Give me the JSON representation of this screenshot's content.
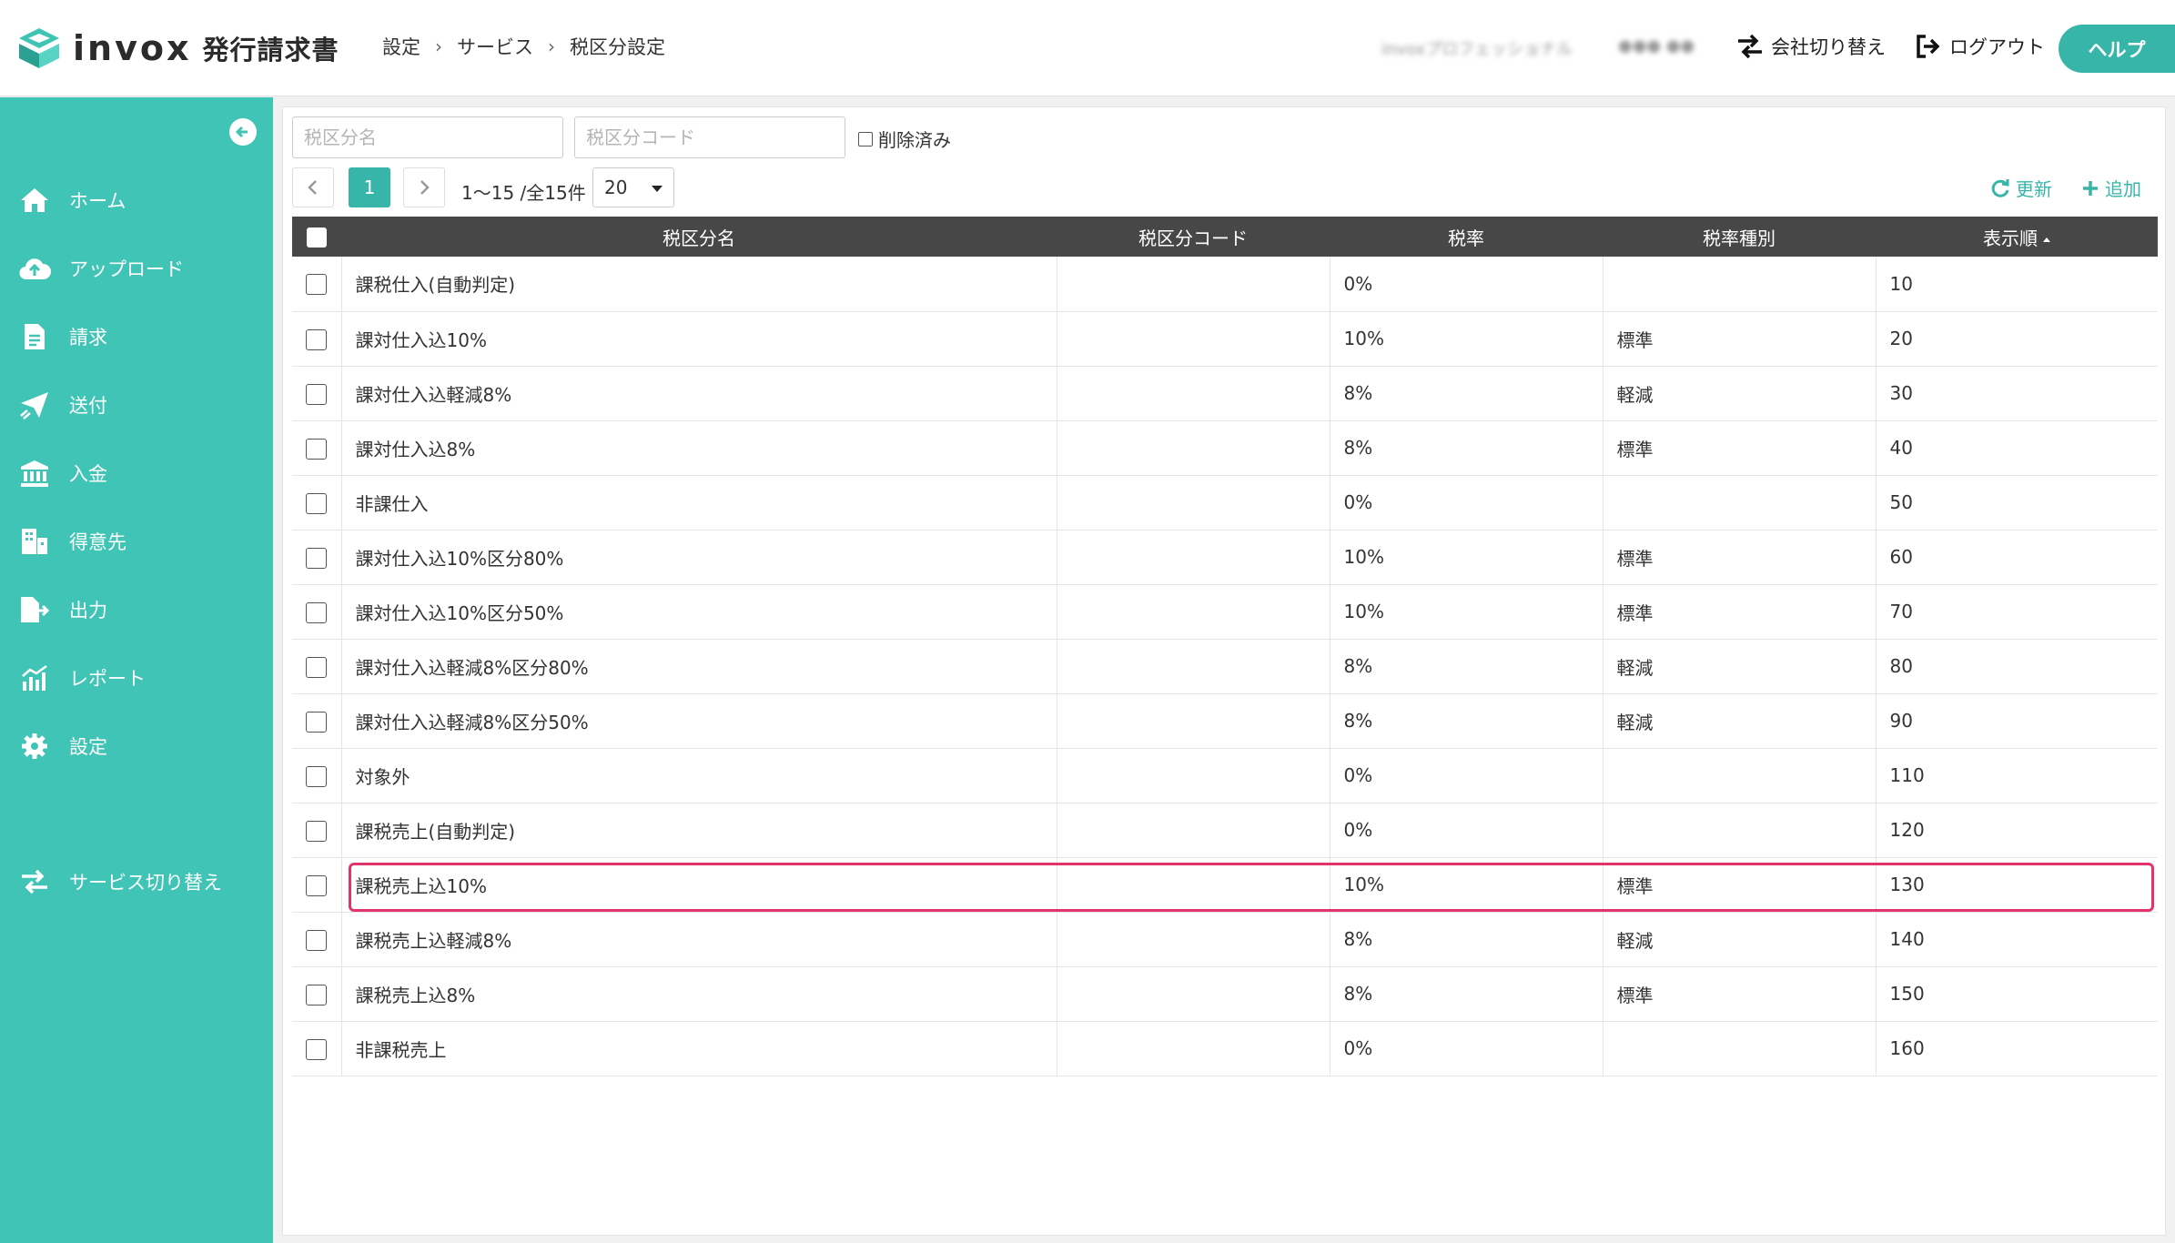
{
  "header": {
    "logo_text": "invox",
    "logo_sub": "発行請求書",
    "breadcrumb": [
      "設定",
      "サービス",
      "税区分設定"
    ],
    "blurred_company": "invoxプロフェッショナル",
    "blurred_user": "●●● ●●",
    "switch_company": "会社切り替え",
    "logout": "ログアウト",
    "help": "ヘルプ"
  },
  "sidebar": {
    "items": [
      {
        "label": "ホーム",
        "icon": "home-icon"
      },
      {
        "label": "アップロード",
        "icon": "cloud-upload-icon"
      },
      {
        "label": "請求",
        "icon": "document-icon"
      },
      {
        "label": "送付",
        "icon": "paper-plane-icon"
      },
      {
        "label": "入金",
        "icon": "bank-icon"
      },
      {
        "label": "得意先",
        "icon": "building-icon"
      },
      {
        "label": "出力",
        "icon": "file-export-icon"
      },
      {
        "label": "レポート",
        "icon": "chart-icon"
      },
      {
        "label": "設定",
        "icon": "gear-icon"
      }
    ],
    "service_switch": "サービス切り替え"
  },
  "filters": {
    "name_placeholder": "税区分名",
    "code_placeholder": "税区分コード",
    "deleted_label": "削除済み"
  },
  "pager": {
    "current": "1",
    "info": "1〜15 /全15件",
    "page_size": "20"
  },
  "toolbar": {
    "refresh": "更新",
    "add": "追加"
  },
  "table": {
    "columns": [
      "税区分名",
      "税区分コード",
      "税率",
      "税率種別",
      "表示順"
    ],
    "rows": [
      {
        "name": "課税仕入(自動判定)",
        "code": "",
        "rate": "0%",
        "type": "",
        "order": "10"
      },
      {
        "name": "課対仕入込10%",
        "code": "",
        "rate": "10%",
        "type": "標準",
        "order": "20"
      },
      {
        "name": "課対仕入込軽減8%",
        "code": "",
        "rate": "8%",
        "type": "軽減",
        "order": "30"
      },
      {
        "name": "課対仕入込8%",
        "code": "",
        "rate": "8%",
        "type": "標準",
        "order": "40"
      },
      {
        "name": "非課仕入",
        "code": "",
        "rate": "0%",
        "type": "",
        "order": "50"
      },
      {
        "name": "課対仕入込10%区分80%",
        "code": "",
        "rate": "10%",
        "type": "標準",
        "order": "60"
      },
      {
        "name": "課対仕入込10%区分50%",
        "code": "",
        "rate": "10%",
        "type": "標準",
        "order": "70"
      },
      {
        "name": "課対仕入込軽減8%区分80%",
        "code": "",
        "rate": "8%",
        "type": "軽減",
        "order": "80"
      },
      {
        "name": "課対仕入込軽減8%区分50%",
        "code": "",
        "rate": "8%",
        "type": "軽減",
        "order": "90"
      },
      {
        "name": "対象外",
        "code": "",
        "rate": "0%",
        "type": "",
        "order": "110"
      },
      {
        "name": "課税売上(自動判定)",
        "code": "",
        "rate": "0%",
        "type": "",
        "order": "120"
      },
      {
        "name": "課税売上込10%",
        "code": "",
        "rate": "10%",
        "type": "標準",
        "order": "130"
      },
      {
        "name": "課税売上込軽減8%",
        "code": "",
        "rate": "8%",
        "type": "軽減",
        "order": "140"
      },
      {
        "name": "課税売上込8%",
        "code": "",
        "rate": "8%",
        "type": "標準",
        "order": "150"
      },
      {
        "name": "非課税売上",
        "code": "",
        "rate": "0%",
        "type": "",
        "order": "160"
      }
    ]
  },
  "colors": {
    "accent": "#36b5a8",
    "sidebar": "#40c4b6",
    "table_header": "#474747",
    "highlight": "#e0346a"
  }
}
